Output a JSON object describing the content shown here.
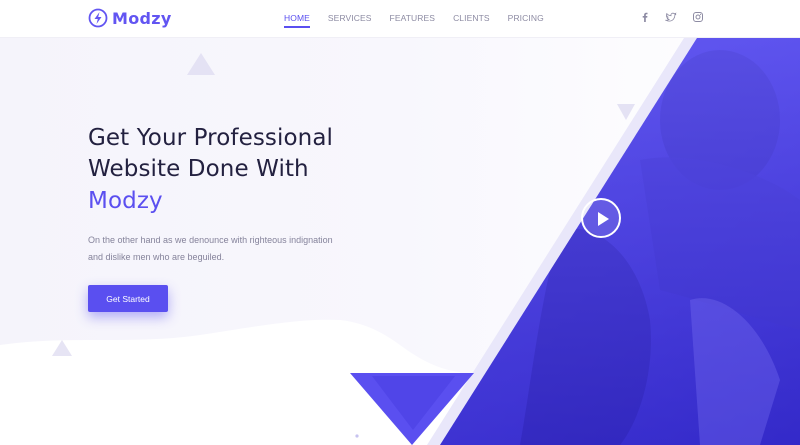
{
  "brand": {
    "name": "Modzy",
    "primary_color": "#5a4ff0",
    "logo_icon": "lightning-circle-icon"
  },
  "nav": {
    "items": [
      {
        "label": "HOME",
        "active": true
      },
      {
        "label": "SERVICES",
        "active": false
      },
      {
        "label": "FEATURES",
        "active": false
      },
      {
        "label": "CLIENTS",
        "active": false
      },
      {
        "label": "PRICING",
        "active": false
      }
    ]
  },
  "social": [
    {
      "icon": "facebook-icon"
    },
    {
      "icon": "twitter-icon"
    },
    {
      "icon": "instagram-icon"
    }
  ],
  "hero": {
    "title_line1": "Get Your Professional",
    "title_line2": "Website Done With",
    "title_brand": "Modzy",
    "subtitle": "On the other hand as we denounce with righteous indignation and dislike men who are beguiled.",
    "cta_label": "Get Started",
    "play_icon": "play-icon"
  },
  "colors": {
    "accent": "#5a4ff0",
    "heading": "#232140",
    "body_text": "#85839b",
    "nav_text": "#8d8ba3"
  }
}
